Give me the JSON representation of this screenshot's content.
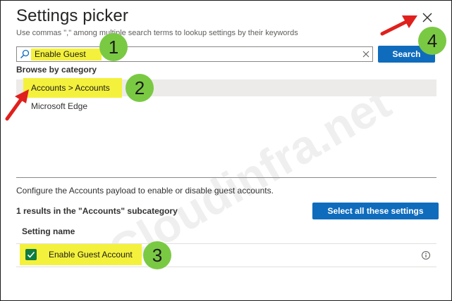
{
  "dialog": {
    "title": "Settings picker",
    "subtitle": "Use commas \",\" among multiple search terms to lookup settings by their keywords"
  },
  "search": {
    "value": "Enable Guest",
    "button_label": "Search"
  },
  "browse": {
    "label": "Browse by category",
    "categories": [
      {
        "label": "Accounts > Accounts",
        "selected": true
      },
      {
        "label": "Microsoft Edge",
        "selected": false
      }
    ]
  },
  "details": {
    "description": "Configure the Accounts payload to enable or disable guest accounts.",
    "results_text": "1 results in the \"Accounts\" subcategory",
    "select_all_label": "Select all these settings",
    "column_header": "Setting name",
    "settings": [
      {
        "label": "Enable Guest Account",
        "checked": true
      }
    ]
  },
  "watermark": "Cloudinfra.net",
  "callouts": [
    "1",
    "2",
    "3",
    "4"
  ],
  "colors": {
    "primary": "#0f6cbd",
    "checkbox": "#107c41",
    "highlight": "#f4f13c",
    "callout": "#7ac943",
    "arrow": "#e0201c"
  }
}
